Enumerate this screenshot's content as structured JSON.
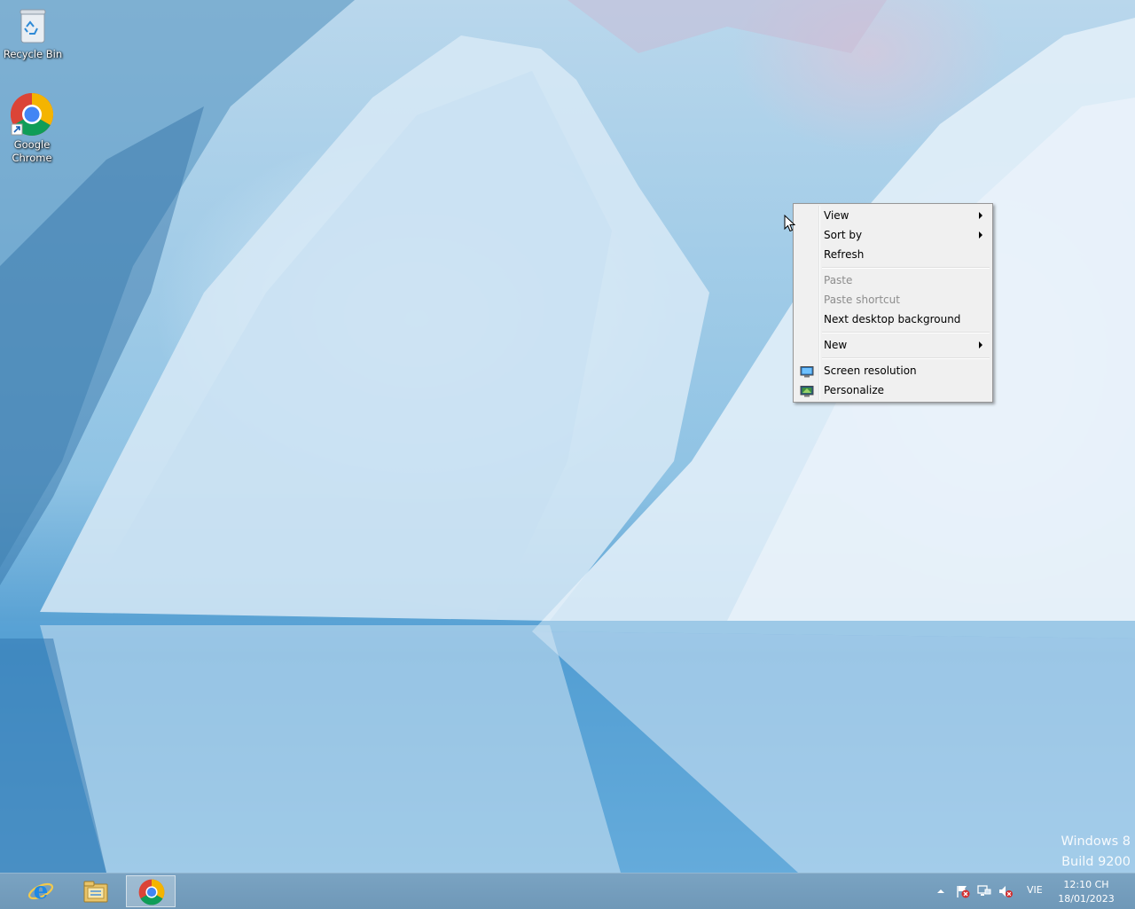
{
  "desktop": {
    "icons": [
      {
        "label": "Recycle Bin"
      },
      {
        "label": "Google Chrome"
      }
    ]
  },
  "context_menu": {
    "items": [
      {
        "label": "View",
        "submenu": true,
        "enabled": true
      },
      {
        "label": "Sort by",
        "submenu": true,
        "enabled": true
      },
      {
        "label": "Refresh",
        "enabled": true
      },
      {
        "label": "Paste",
        "enabled": false
      },
      {
        "label": "Paste shortcut",
        "enabled": false
      },
      {
        "label": "Next desktop background",
        "enabled": true
      },
      {
        "label": "New",
        "submenu": true,
        "enabled": true
      },
      {
        "label": "Screen resolution",
        "icon": "monitor-icon",
        "enabled": true
      },
      {
        "label": "Personalize",
        "icon": "personalize-icon",
        "enabled": true
      }
    ]
  },
  "watermark": {
    "line1": "Windows 8",
    "line2": "Build 9200"
  },
  "taskbar": {
    "pinned": [
      {
        "icon": "internet-explorer-icon"
      },
      {
        "icon": "file-explorer-icon"
      },
      {
        "icon": "chrome-icon",
        "active": true
      }
    ],
    "tray": {
      "icons": [
        "show-hidden-icons",
        "action-center-flag-icon",
        "network-icon",
        "volume-muted-icon"
      ],
      "language": "VIE",
      "time": "12:10 CH",
      "date": "18/01/2023"
    }
  },
  "colors": {
    "taskbar": "#7199b9",
    "menu_bg": "#f0f0f0",
    "menu_border": "#979797",
    "disabled_text": "#8d8d8d"
  }
}
